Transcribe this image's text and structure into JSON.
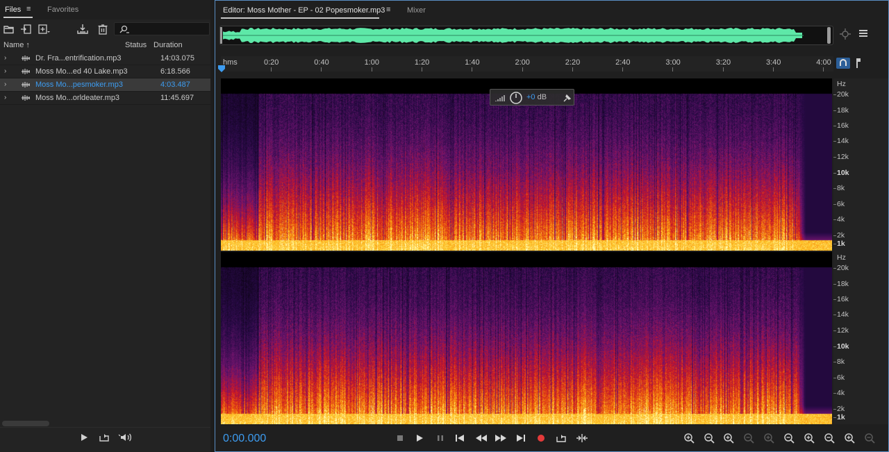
{
  "files_panel": {
    "tabs": {
      "files": "Files",
      "favorites": "Favorites"
    },
    "menu_glyph": "≡",
    "columns": {
      "name": "Name",
      "sort_arrow": "↑",
      "status": "Status",
      "duration": "Duration"
    },
    "files": [
      {
        "name": "Dr. Fra...entrification.mp3",
        "duration": "14:03.075",
        "selected": false
      },
      {
        "name": "Moss Mo...ed 40 Lake.mp3",
        "duration": "6:18.566",
        "selected": false
      },
      {
        "name": "Moss Mo...pesmoker.mp3",
        "duration": "4:03.487",
        "selected": true
      },
      {
        "name": "Moss Mo...orldeater.mp3",
        "duration": "11:45.697",
        "selected": false
      }
    ],
    "toolbar_icons": [
      "open-folder-icon",
      "import-icon",
      "new-file-icon",
      "insert-into-multitrack-icon",
      "trash-icon",
      "search-icon"
    ],
    "bottom_icons": [
      "play-icon",
      "loop-icon",
      "speaker-icon"
    ]
  },
  "editor": {
    "tab_title": "Editor: Moss Mother - EP - 02 Popesmoker.mp3",
    "menu_glyph": "≡",
    "mixer_tab": "Mixer",
    "timeline": {
      "unit": "hms",
      "ticks": [
        "0:20",
        "0:40",
        "1:00",
        "1:20",
        "1:40",
        "2:00",
        "2:20",
        "2:40",
        "3:00",
        "3:20",
        "3:40",
        "4:00"
      ]
    },
    "hud": {
      "gain": "+0",
      "unit": "dB"
    },
    "hz_scale": {
      "unit": "Hz",
      "labels": [
        "20k",
        "18k",
        "16k",
        "14k",
        "12k",
        "10k",
        "8k",
        "6k",
        "4k",
        "2k",
        "1k"
      ]
    },
    "time_display": "0:00.000",
    "colors": {
      "accent": "#3d9cf0",
      "waveform": "#5ee8a8",
      "border": "#5a8ec4"
    }
  }
}
